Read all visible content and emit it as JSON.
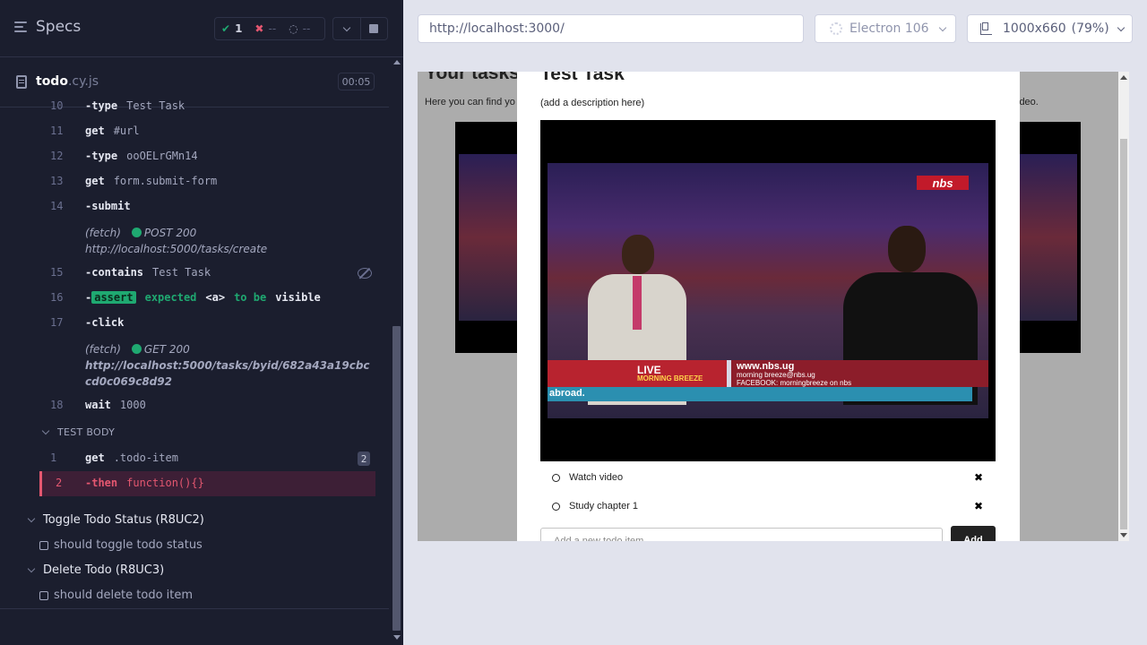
{
  "left": {
    "title": "Specs",
    "stats": {
      "passed": "1",
      "failed": "--",
      "pending": "--"
    },
    "file": {
      "name": "todo",
      "ext": ".cy.js",
      "timer": "00:05"
    },
    "commands": [
      {
        "num": "10",
        "name": "-type",
        "arg": "Test Task"
      },
      {
        "num": "11",
        "name": "get",
        "arg": "#url"
      },
      {
        "num": "12",
        "name": "-type",
        "arg": "ooOELrGMn14"
      },
      {
        "num": "13",
        "name": "get",
        "arg": "form.submit-form"
      },
      {
        "num": "14",
        "name": "-submit",
        "arg": ""
      },
      {
        "num": "15",
        "name": "-contains",
        "arg": "Test Task"
      },
      {
        "num": "16",
        "name": "-",
        "arg": ""
      },
      {
        "num": "17",
        "name": "-click",
        "arg": ""
      },
      {
        "num": "18",
        "name": "wait",
        "arg": "1000"
      }
    ],
    "xhr1": {
      "label": "(fetch)",
      "method": "POST 200",
      "url": "http://localhost:5000/tasks/create"
    },
    "xhr2": {
      "label": "(fetch)",
      "method": "GET 200",
      "url": "http://localhost:5000/tasks/byid/682a43a19cbccd0c069c8d92"
    },
    "assert": {
      "badge": "assert",
      "expected": "expected",
      "subject": "<a>",
      "tobe": "to be",
      "state": "visible"
    },
    "test_body": {
      "header": "TEST BODY",
      "rows": [
        {
          "num": "1",
          "name": "get",
          "arg": ".todo-item",
          "badge": "2"
        },
        {
          "num": "2",
          "name": "-then",
          "arg": "function(){}"
        }
      ]
    },
    "suites": [
      {
        "title": "Toggle Todo Status (R8UC2)",
        "test": "should toggle todo status"
      },
      {
        "title": "Delete Todo (R8UC3)",
        "test": "should delete todo item"
      }
    ]
  },
  "right": {
    "url": "http://localhost:3000/",
    "browser": "Electron 106",
    "viewport": "1000x660",
    "zoom": "(79%)",
    "app": {
      "heading": "Your tasks",
      "desc_left": "Here you can find yo",
      "desc_right": "ideo.",
      "modal": {
        "title": "Test Task",
        "description": "(add a description here)",
        "video": {
          "channel_logo": "nbs",
          "live": "LIVE",
          "show": "MORNING BREEZE",
          "site": "www.nbs.ug",
          "email": "morning breeze@nbs.ug",
          "facebook": "FACEBOOK: morningbreeze on nbs",
          "ticker": "abroad."
        },
        "todos": [
          {
            "label": "Watch video"
          },
          {
            "label": "Study chapter 1"
          }
        ],
        "add_placeholder": "Add a new todo item",
        "add_button": "Add"
      }
    }
  },
  "colors": {
    "pass": "#1fa971",
    "fail": "#e45770",
    "panel": "#1b1e2e"
  },
  "icons": [
    "menu-icon",
    "check-icon",
    "x-icon",
    "spinner-icon",
    "chevron-down-icon",
    "stop-icon",
    "file-icon",
    "eye-slash-icon",
    "gear-icon",
    "ruler-icon",
    "delete-icon"
  ]
}
